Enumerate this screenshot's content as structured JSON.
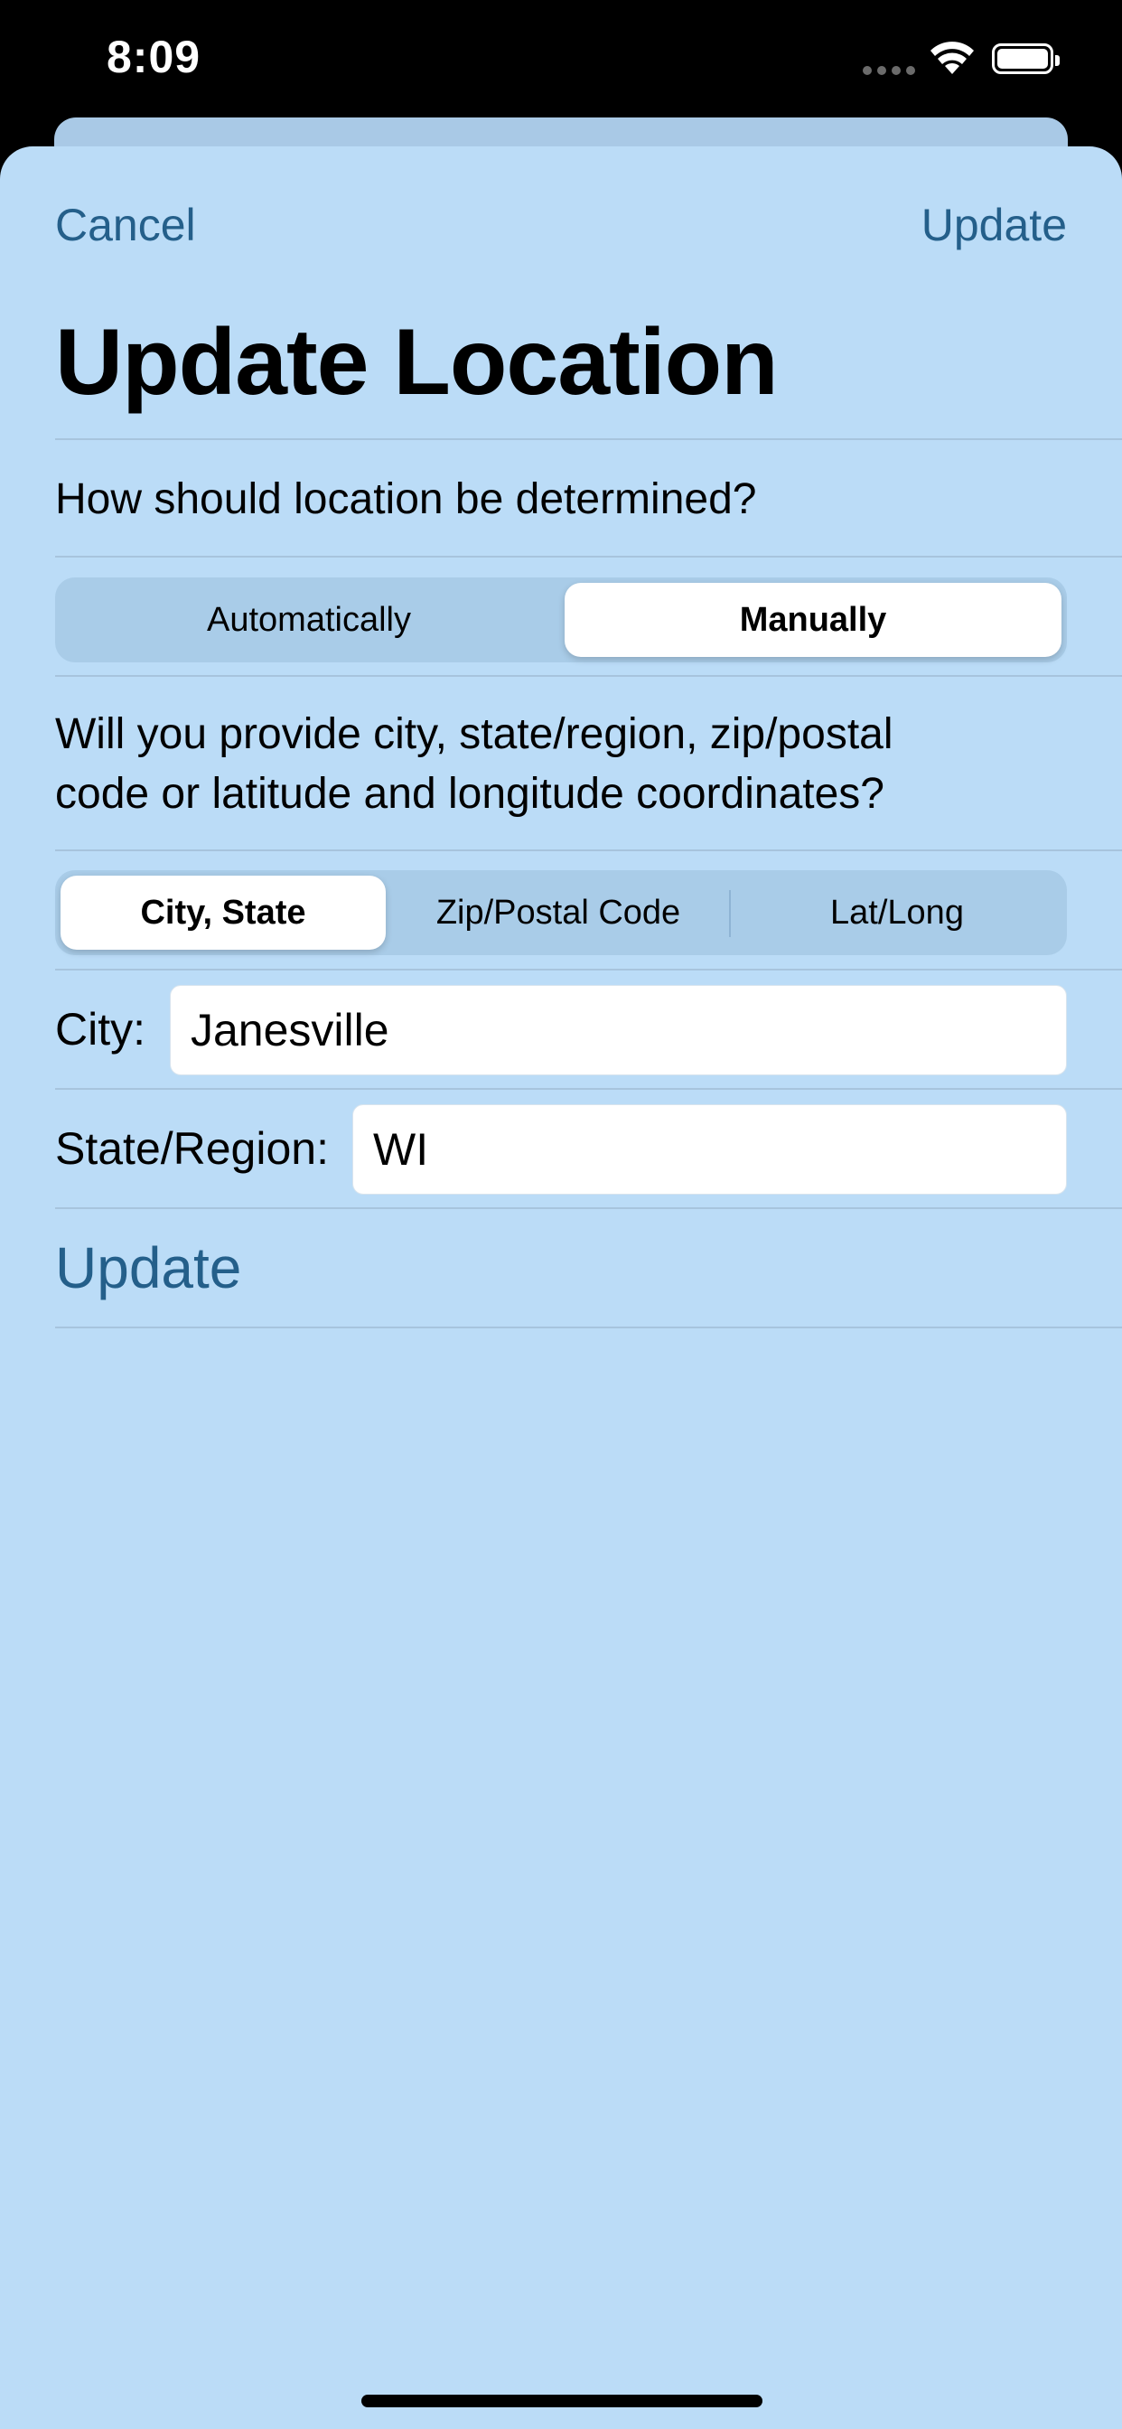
{
  "status_bar": {
    "time": "8:09"
  },
  "nav": {
    "cancel_label": "Cancel",
    "update_label": "Update"
  },
  "title": "Update Location",
  "question1": "How should location be determined?",
  "method_segment": {
    "options": [
      "Automatically",
      "Manually"
    ],
    "selected": "Manually"
  },
  "question2_line1": "Will you provide city, state/region, zip/postal",
  "question2_line2": "code or latitude and longitude coordinates?",
  "input_type_segment": {
    "options": [
      "City, State",
      "Zip/Postal Code",
      "Lat/Long"
    ],
    "selected": "City, State"
  },
  "form": {
    "city_label": "City:",
    "city_value": "Janesville",
    "state_label": "State/Region:",
    "state_value": "WI"
  },
  "update_button_label": "Update",
  "icons": [
    "cellular-signal-icon",
    "wifi-icon",
    "battery-icon"
  ]
}
